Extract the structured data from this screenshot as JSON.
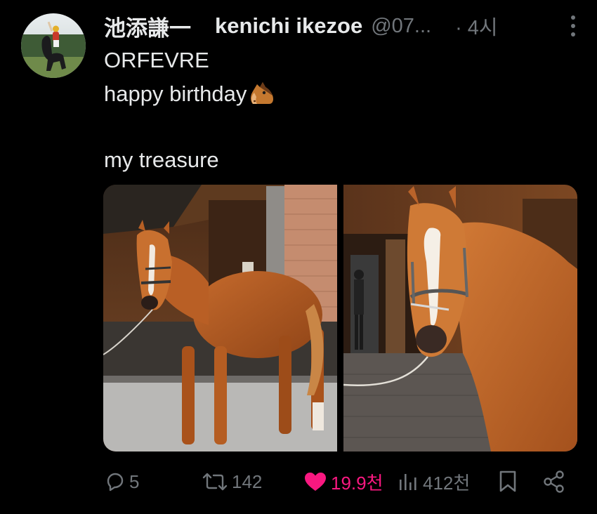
{
  "post": {
    "author": {
      "display_name": "池添謙一",
      "name": "kenichi ikezoe",
      "handle": "@07..."
    },
    "time": "· 4시",
    "text_lines": [
      "ORFEVRE",
      "happy birthday",
      "my treasure"
    ],
    "emoji": "horse-face"
  },
  "actions": {
    "replies": "5",
    "reposts": "142",
    "likes": "19.9천",
    "views": "412천"
  },
  "colors": {
    "background": "#000000",
    "text": "#e7e9ea",
    "muted": "#71767b",
    "like": "#f91880"
  }
}
